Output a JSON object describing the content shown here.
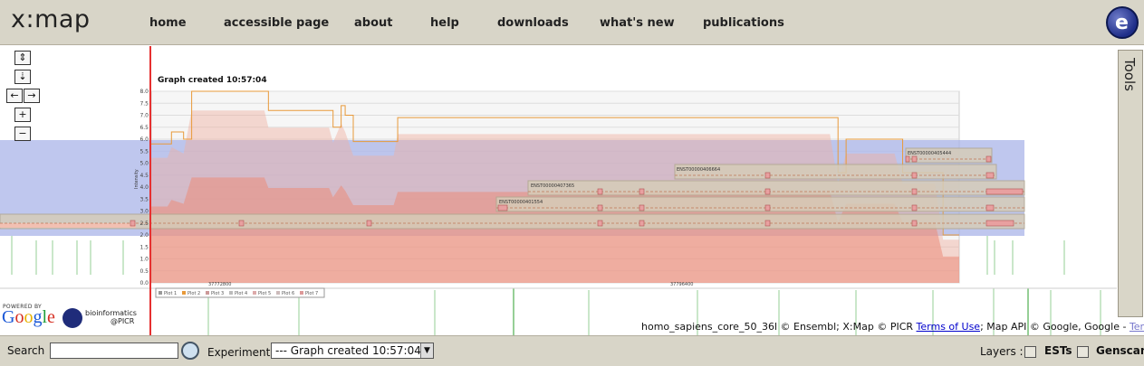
{
  "app": {
    "logo": "x:map"
  },
  "nav": {
    "items": [
      {
        "label": "home"
      },
      {
        "label": "accessible page"
      },
      {
        "label": "about"
      },
      {
        "label": "help"
      },
      {
        "label": "downloads"
      },
      {
        "label": "what's new"
      },
      {
        "label": "publications"
      }
    ]
  },
  "map_controls": {
    "up_down": "⇕",
    "collapse": "⇣",
    "left": "←",
    "right": "→",
    "zoom_in": "+",
    "zoom_out": "−"
  },
  "tools_label": "Tools",
  "graph": {
    "title": "Graph created 10:57:04",
    "ylabel": "Intensity",
    "yticks": [
      "8.0",
      "7.5",
      "7.0",
      "6.5",
      "6.0",
      "5.5",
      "5.0",
      "4.5",
      "4.0",
      "3.5",
      "3.0",
      "2.5",
      "2.0",
      "1.5",
      "1.0",
      "0.5",
      "0.0"
    ],
    "xticks": [
      "37772800",
      "37796400"
    ],
    "legend": [
      "Plot 1",
      "Plot 2",
      "Plot 3",
      "Plot 4",
      "Plot 5",
      "Plot 6",
      "Plot 7"
    ],
    "transcripts": [
      "ENST00000405444",
      "ENST00000406664",
      "ENST00000407365",
      "ENST00000401554"
    ]
  },
  "chart_data": {
    "type": "line",
    "title": "Graph created 10:57:04",
    "xlabel": "",
    "ylabel": "Intensity",
    "ylim": [
      0,
      8
    ],
    "x_tick_labels": [
      "37772800",
      "37796400"
    ],
    "series": [
      {
        "name": "Plot 2",
        "x_fraction": [
          0.0,
          0.02,
          0.025,
          0.04,
          0.05,
          0.14,
          0.145,
          0.22,
          0.225,
          0.235,
          0.24,
          0.25,
          0.3,
          0.305,
          0.84,
          0.85,
          0.86,
          0.92,
          0.93,
          0.97,
          0.98,
          1.0
        ],
        "values": [
          5.8,
          5.8,
          6.3,
          6.0,
          8.0,
          8.0,
          7.2,
          7.2,
          6.5,
          7.4,
          7.0,
          5.9,
          5.9,
          6.9,
          6.9,
          4.6,
          6.0,
          6.0,
          4.6,
          4.6,
          2.0,
          2.0
        ]
      }
    ]
  },
  "footer": {
    "powered_by": "POWERED BY",
    "google": "Google",
    "bioinformatics": "bioinformatics",
    "picr": "@PICR",
    "attribution_prefix": "homo_sapiens_core_50_36l © Ensembl; X:Map © PICR ",
    "terms1": "Terms of Use",
    "attribution_mid": "; Map API © Google, Google - ",
    "terms2": "Terms of Use"
  },
  "bottom": {
    "search_label": "Search",
    "search_value": "",
    "experiment_label": "Experiment:",
    "experiment_value": "--- Graph created 10:57:04",
    "layers_label": "Layers :",
    "layer1": "ESTs",
    "layer2": "Genscan"
  },
  "colors": {
    "accent": "#e63030",
    "graph_line": "#e89a3a",
    "band": "#aab4e8"
  }
}
